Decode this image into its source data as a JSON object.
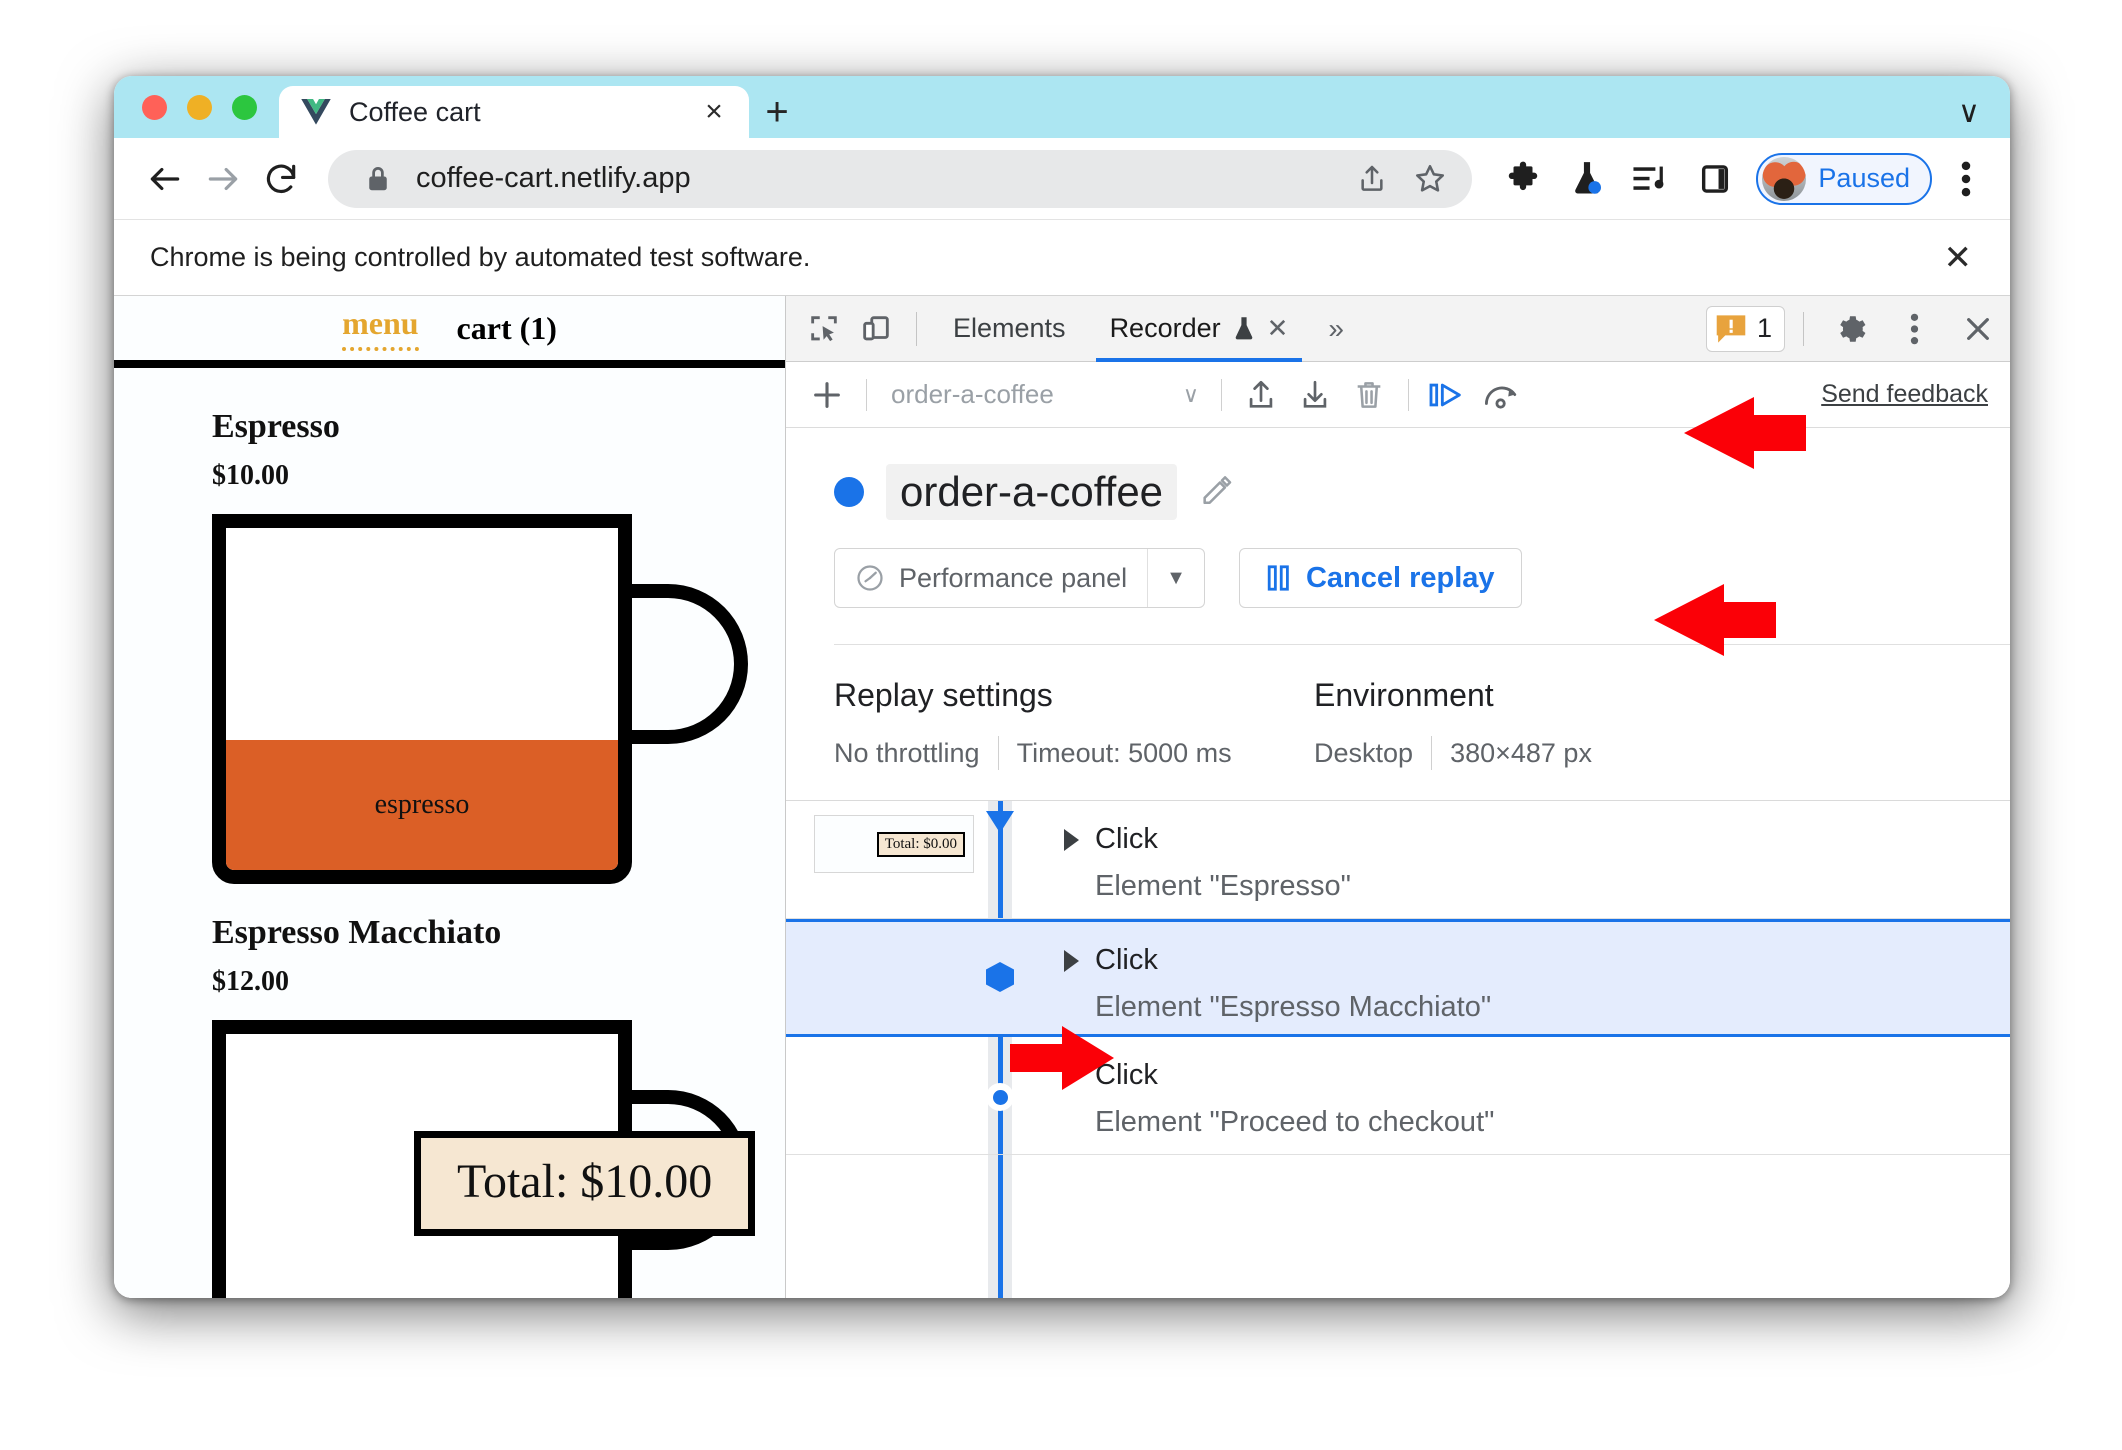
{
  "browser": {
    "tab": {
      "title": "Coffee cart",
      "favicon": "vue-logo-icon",
      "close_label": "×"
    },
    "new_tab_label": "+",
    "window_chevron": "∨",
    "url": "coffee-cart.netlify.app",
    "lock_icon": "lock-icon",
    "profile_label": "Paused",
    "infobar": {
      "message": "Chrome is being controlled by automated test software.",
      "close_label": "✕"
    }
  },
  "page": {
    "nav": {
      "menu": "menu",
      "cart": "cart (1)"
    },
    "items": [
      {
        "name": "Espresso",
        "price": "$10.00",
        "cup_label": "espresso"
      },
      {
        "name": "Espresso Macchiato",
        "price": "$12.00",
        "cup_label": ""
      }
    ],
    "total_tooltip": "Total: $10.00"
  },
  "devtools": {
    "tabs": [
      {
        "label": "Elements",
        "selected": false
      },
      {
        "label": "Recorder",
        "selected": true,
        "beta_icon": "flask-icon",
        "close_label": "✕"
      }
    ],
    "more_tabs_label": "»",
    "warning_badge": {
      "icon": "warning-message-icon",
      "count": "1"
    },
    "settings_icon": "gear-icon",
    "menu_icon": "kebab-menu-icon",
    "close_icon": "close-icon",
    "inspect_icon": "inspect-element-icon",
    "device_icon": "device-toolbar-icon"
  },
  "recorder": {
    "toolbar": {
      "add_label": "+",
      "selected_recording": "order-a-coffee",
      "dropdown_caret": "∨",
      "export_icon": "export-icon",
      "import_icon": "import-icon",
      "delete_icon": "trash-icon",
      "step_replay_icon": "step-by-step-replay-icon",
      "performance_replay_icon": "measure-performance-icon",
      "feedback_label": "Send feedback"
    },
    "recording_name": "order-a-coffee",
    "edit_icon": "pencil-icon",
    "replay_target": "Performance panel",
    "replay_target_icon": "speedometer-icon",
    "replay_target_caret": "▼",
    "cancel_button": "Cancel replay",
    "cancel_icon": "pause-icon",
    "settings": {
      "replay_title": "Replay settings",
      "replay_values": [
        "No throttling",
        "Timeout: 5000 ms"
      ],
      "environment_title": "Environment",
      "environment_values": [
        "Desktop",
        "380×487 px"
      ]
    },
    "steps": [
      {
        "type": "Click",
        "target": "Element \"Espresso\"",
        "marker": "arrowdown",
        "selected": false,
        "thumbnail_text": "Total: $0.00"
      },
      {
        "type": "Click",
        "target": "Element \"Espresso Macchiato\"",
        "marker": "hex",
        "selected": true,
        "thumbnail_text": ""
      },
      {
        "type": "Click",
        "target": "Element \"Proceed to checkout\"",
        "marker": "dot",
        "selected": false,
        "thumbnail_text": ""
      }
    ]
  },
  "colors": {
    "accent_blue": "#1a73e8",
    "tabstrip": "#ace6f2",
    "espresso_orange": "#db5f26",
    "annotation_red": "#fb0007",
    "menu_gold": "#e4a62f"
  }
}
